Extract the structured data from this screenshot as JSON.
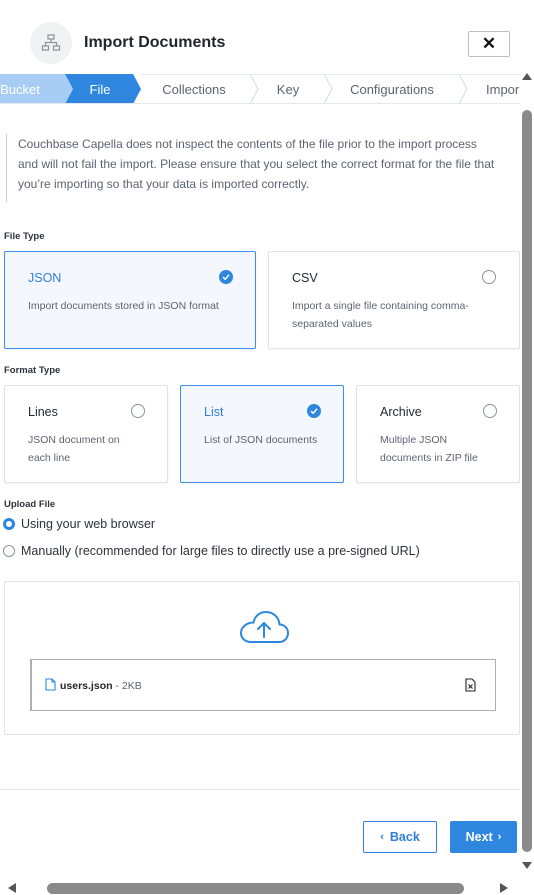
{
  "header": {
    "title": "Import Documents",
    "logo_icon": "network-icon",
    "close_label": "✕"
  },
  "stepper": {
    "steps": [
      {
        "label": "Bucket",
        "state": "done"
      },
      {
        "label": "File",
        "state": "active"
      },
      {
        "label": "Collections",
        "state": "pending"
      },
      {
        "label": "Key",
        "state": "pending"
      },
      {
        "label": "Configurations",
        "state": "pending"
      },
      {
        "label": "Impor",
        "state": "pending"
      }
    ],
    "done_color": "#a8cdf4",
    "active_color": "#2e86de"
  },
  "notice": {
    "line1": "Couchbase Capella does not inspect the contents of the file prior to the import process",
    "line2": "and will not fail the import. Please ensure that you select the correct format for the file that",
    "line3": "you’re importing so that your data is imported correctly."
  },
  "file_type": {
    "label": "File Type",
    "options": [
      {
        "title": "JSON",
        "desc_line1": "Import documents stored in JSON format",
        "desc_line2": "",
        "selected": true
      },
      {
        "title": "CSV",
        "desc_line1": "Import a single file containing comma-",
        "desc_line2": "separated values",
        "selected": false
      }
    ]
  },
  "format_type": {
    "label": "Format Type",
    "options": [
      {
        "title": "Lines",
        "desc_line1": "JSON document on",
        "desc_line2": "each line",
        "selected": false
      },
      {
        "title": "List",
        "desc_line1": "List of JSON documents",
        "desc_line2": "",
        "selected": true
      },
      {
        "title": "Archive",
        "desc_line1": "Multiple JSON",
        "desc_line2": "documents in ZIP file",
        "selected": false
      }
    ]
  },
  "upload": {
    "label": "Upload File",
    "options": [
      {
        "label": "Using your web browser",
        "selected": true
      },
      {
        "label": "Manually (recommended for large files to directly use a pre-signed URL)",
        "selected": false
      }
    ],
    "file_name": "users.json",
    "file_size": " - 2KB"
  },
  "footer": {
    "back_label": "Back",
    "next_label": "Next"
  },
  "colors": {
    "accent": "#2e86de",
    "selected_border": "#3b8ee8"
  }
}
